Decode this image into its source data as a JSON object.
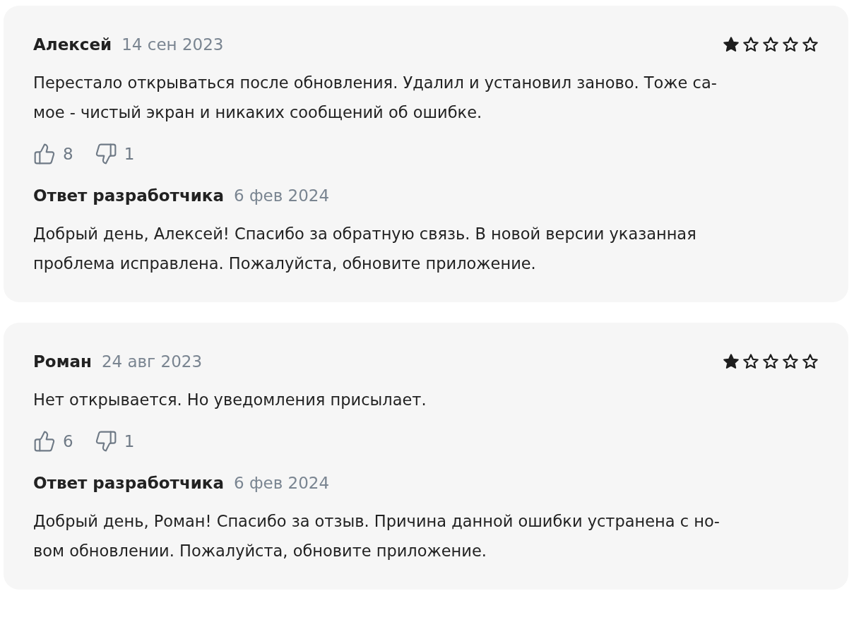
{
  "reviews": [
    {
      "author": "Алексей",
      "date": "14 сен 2023",
      "stars": 1,
      "text": "Перестало открываться после обновления. Удалил и установил заново. Тоже са-\nмое - чистый экран и никаких сообщений об ошибке.",
      "likes": "8",
      "dislikes": "1",
      "reply": {
        "title": "Ответ разработчика",
        "date": "6 фев 2024",
        "text": "Добрый день, Алексей! Спасибо за обратную связь. В новой версии указанная\nпроблема исправлена. Пожалуйста, обновите приложение."
      }
    },
    {
      "author": "Роман",
      "date": "24 авг 2023",
      "stars": 1,
      "text": "Нет открывается. Но уведомления присылает.",
      "likes": "6",
      "dislikes": "1",
      "reply": {
        "title": "Ответ разработчика",
        "date": "6 фев 2024",
        "text": "Добрый день, Роман! Спасибо за отзыв. Причина данной ошибки устранена с но-\nвом обновлении. Пожалуйста, обновите приложение."
      }
    }
  ]
}
